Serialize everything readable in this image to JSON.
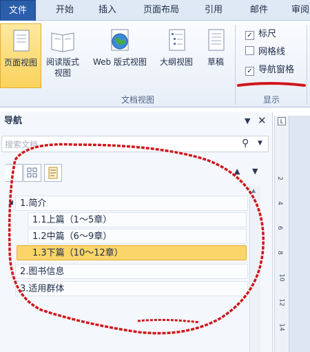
{
  "ribbon_tabs": [
    "文件",
    "开始",
    "插入",
    "页面布局",
    "引用",
    "邮件",
    "审阅"
  ],
  "view_buttons": [
    {
      "label": "页面视图",
      "icon": "page-view-icon"
    },
    {
      "label": "阅读版式\n视图",
      "icon": "reading-view-icon"
    },
    {
      "label": "Web 版式视图",
      "icon": "web-view-icon"
    },
    {
      "label": "大纲视图",
      "icon": "outline-view-icon"
    },
    {
      "label": "草稿",
      "icon": "draft-view-icon"
    }
  ],
  "group_labels": {
    "views": "文档视图",
    "show": "显示"
  },
  "show_options": [
    {
      "label": "标尺",
      "checked": true
    },
    {
      "label": "网格线",
      "checked": false
    },
    {
      "label": "导航窗格",
      "checked": true
    }
  ],
  "nav": {
    "title": "导航",
    "search_placeholder": "搜索文档",
    "tree": [
      {
        "label": "1.简介",
        "level": 1,
        "selected": false
      },
      {
        "label": "1.1上篇（1～5章）",
        "level": 2,
        "selected": false
      },
      {
        "label": "1.2中篇（6～9章）",
        "level": 2,
        "selected": false
      },
      {
        "label": "1.3下篇（10～12章）",
        "level": 2,
        "selected": true
      },
      {
        "label": "2.图书信息",
        "level": 1,
        "selected": false
      },
      {
        "label": "3.适用群体",
        "level": 1,
        "selected": false
      }
    ]
  },
  "ruler_numbers": [
    "2",
    "4",
    "6",
    "8",
    "10",
    "12",
    "14"
  ],
  "colors": {
    "accent": "#2a5ea8",
    "selected": "#fcd56a",
    "annotation": "#d0161c"
  }
}
